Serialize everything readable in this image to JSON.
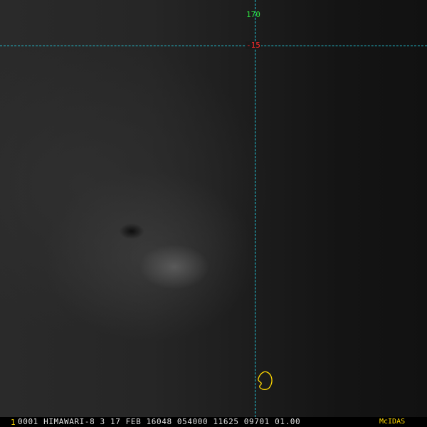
{
  "grid": {
    "longitude_label": "170",
    "latitude_label": "-15"
  },
  "status_bar": {
    "frame_number": "1",
    "info": "0001 HIMAWARI-8  3 17 FEB 16048 054000 11625 09701 01.00",
    "brand": "McIDAS"
  },
  "colors": {
    "grid_line": "#22c6d8",
    "longitude_label": "#2ee040",
    "latitude_label": "#ff2a2a",
    "coastline": "#ffd800",
    "status_text": "#e0e0e0",
    "brand": "#ffd800"
  }
}
